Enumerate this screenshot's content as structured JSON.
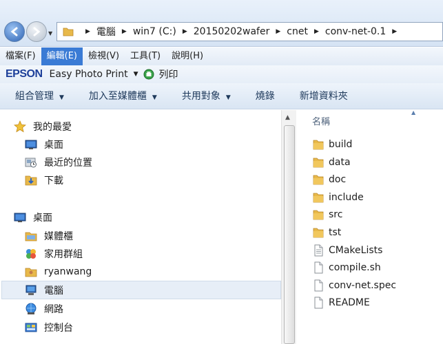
{
  "address": {
    "breadcrumbs": [
      "電腦",
      "win7 (C:)",
      "20150202wafer",
      "cnet",
      "conv-net-0.1"
    ]
  },
  "menu": {
    "items": [
      "檔案(F)",
      "編輯(E)",
      "檢視(V)",
      "工具(T)",
      "說明(H)"
    ],
    "active_index": 1
  },
  "epson": {
    "logo": "EPSON",
    "app": "Easy Photo Print",
    "print": "列印"
  },
  "commands": [
    "組合管理",
    "加入至媒體櫃",
    "共用對象",
    "燒錄",
    "新增資料夾"
  ],
  "nav": {
    "favorites": {
      "label": "我的最愛",
      "icon": "star-icon",
      "items": [
        {
          "label": "桌面",
          "icon": "desktop-icon"
        },
        {
          "label": "最近的位置",
          "icon": "recent-places-icon"
        },
        {
          "label": "下載",
          "icon": "downloads-folder-icon"
        }
      ]
    },
    "desktop": {
      "label": "桌面",
      "icon": "desktop-icon",
      "items": [
        {
          "label": "媒體櫃",
          "icon": "libraries-icon"
        },
        {
          "label": "家用群組",
          "icon": "homegroup-icon"
        },
        {
          "label": "ryanwang",
          "icon": "user-folder-icon"
        },
        {
          "label": "電腦",
          "icon": "computer-icon",
          "selected": true
        },
        {
          "label": "網路",
          "icon": "network-icon"
        },
        {
          "label": "控制台",
          "icon": "control-panel-icon"
        }
      ]
    }
  },
  "content": {
    "column_header": "名稱",
    "files": [
      {
        "name": "build",
        "type": "folder"
      },
      {
        "name": "data",
        "type": "folder"
      },
      {
        "name": "doc",
        "type": "folder"
      },
      {
        "name": "include",
        "type": "folder"
      },
      {
        "name": "src",
        "type": "folder"
      },
      {
        "name": "tst",
        "type": "folder"
      },
      {
        "name": "CMakeLists",
        "type": "file"
      },
      {
        "name": "compile.sh",
        "type": "file"
      },
      {
        "name": "conv-net.spec",
        "type": "file"
      },
      {
        "name": "README",
        "type": "file"
      }
    ]
  },
  "colors": {
    "menu_active": "#3a7bd5",
    "folder": "#e8b94a",
    "command_text": "#1e395b",
    "epson_blue": "#1d3f9a"
  }
}
